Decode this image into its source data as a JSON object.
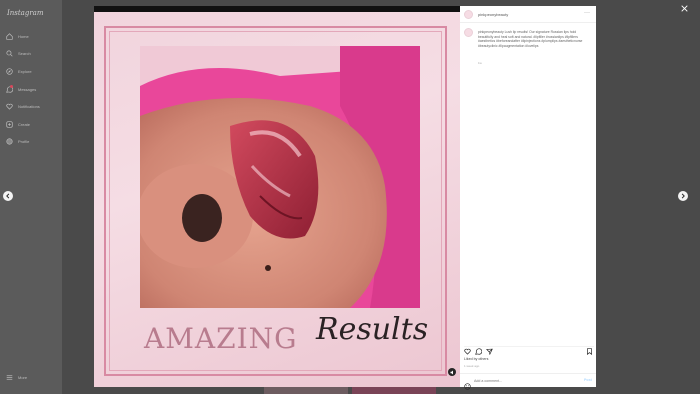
{
  "app": {
    "logo": "Instagram"
  },
  "sidebar": {
    "items": [
      {
        "label": "Home",
        "icon": "home-icon"
      },
      {
        "label": "Search",
        "icon": "search-icon"
      },
      {
        "label": "Explore",
        "icon": "explore-icon"
      },
      {
        "label": "Messages",
        "icon": "messages-icon"
      },
      {
        "label": "Notifications",
        "icon": "heart-icon"
      },
      {
        "label": "Create",
        "icon": "create-icon"
      },
      {
        "label": "Profile",
        "icon": "profile-icon"
      }
    ],
    "more_label": "More"
  },
  "post": {
    "image_text": {
      "word1": "AMAZING",
      "word2": "Results"
    },
    "author": "pinkpeonybeauty",
    "caption": "pinkpeonybeauty Lush lip results! Our signature Russian lips hold beautifully and heal soft and natural. #lipfiller #russianlips #lipfillers #aesthetics #beforeandafter #lipinjections #plumplips #aestheticnurse #beautyclinic #lipaugmentation #lovelips",
    "caption_time": "1w",
    "likes": "Liked by others",
    "date": "1 week ago"
  },
  "comment": {
    "placeholder": "Add a comment...",
    "post_label": "Post"
  },
  "colors": {
    "accent": "#e9479a",
    "frame": "#d88aa3",
    "text_pink": "#b87c8e"
  }
}
